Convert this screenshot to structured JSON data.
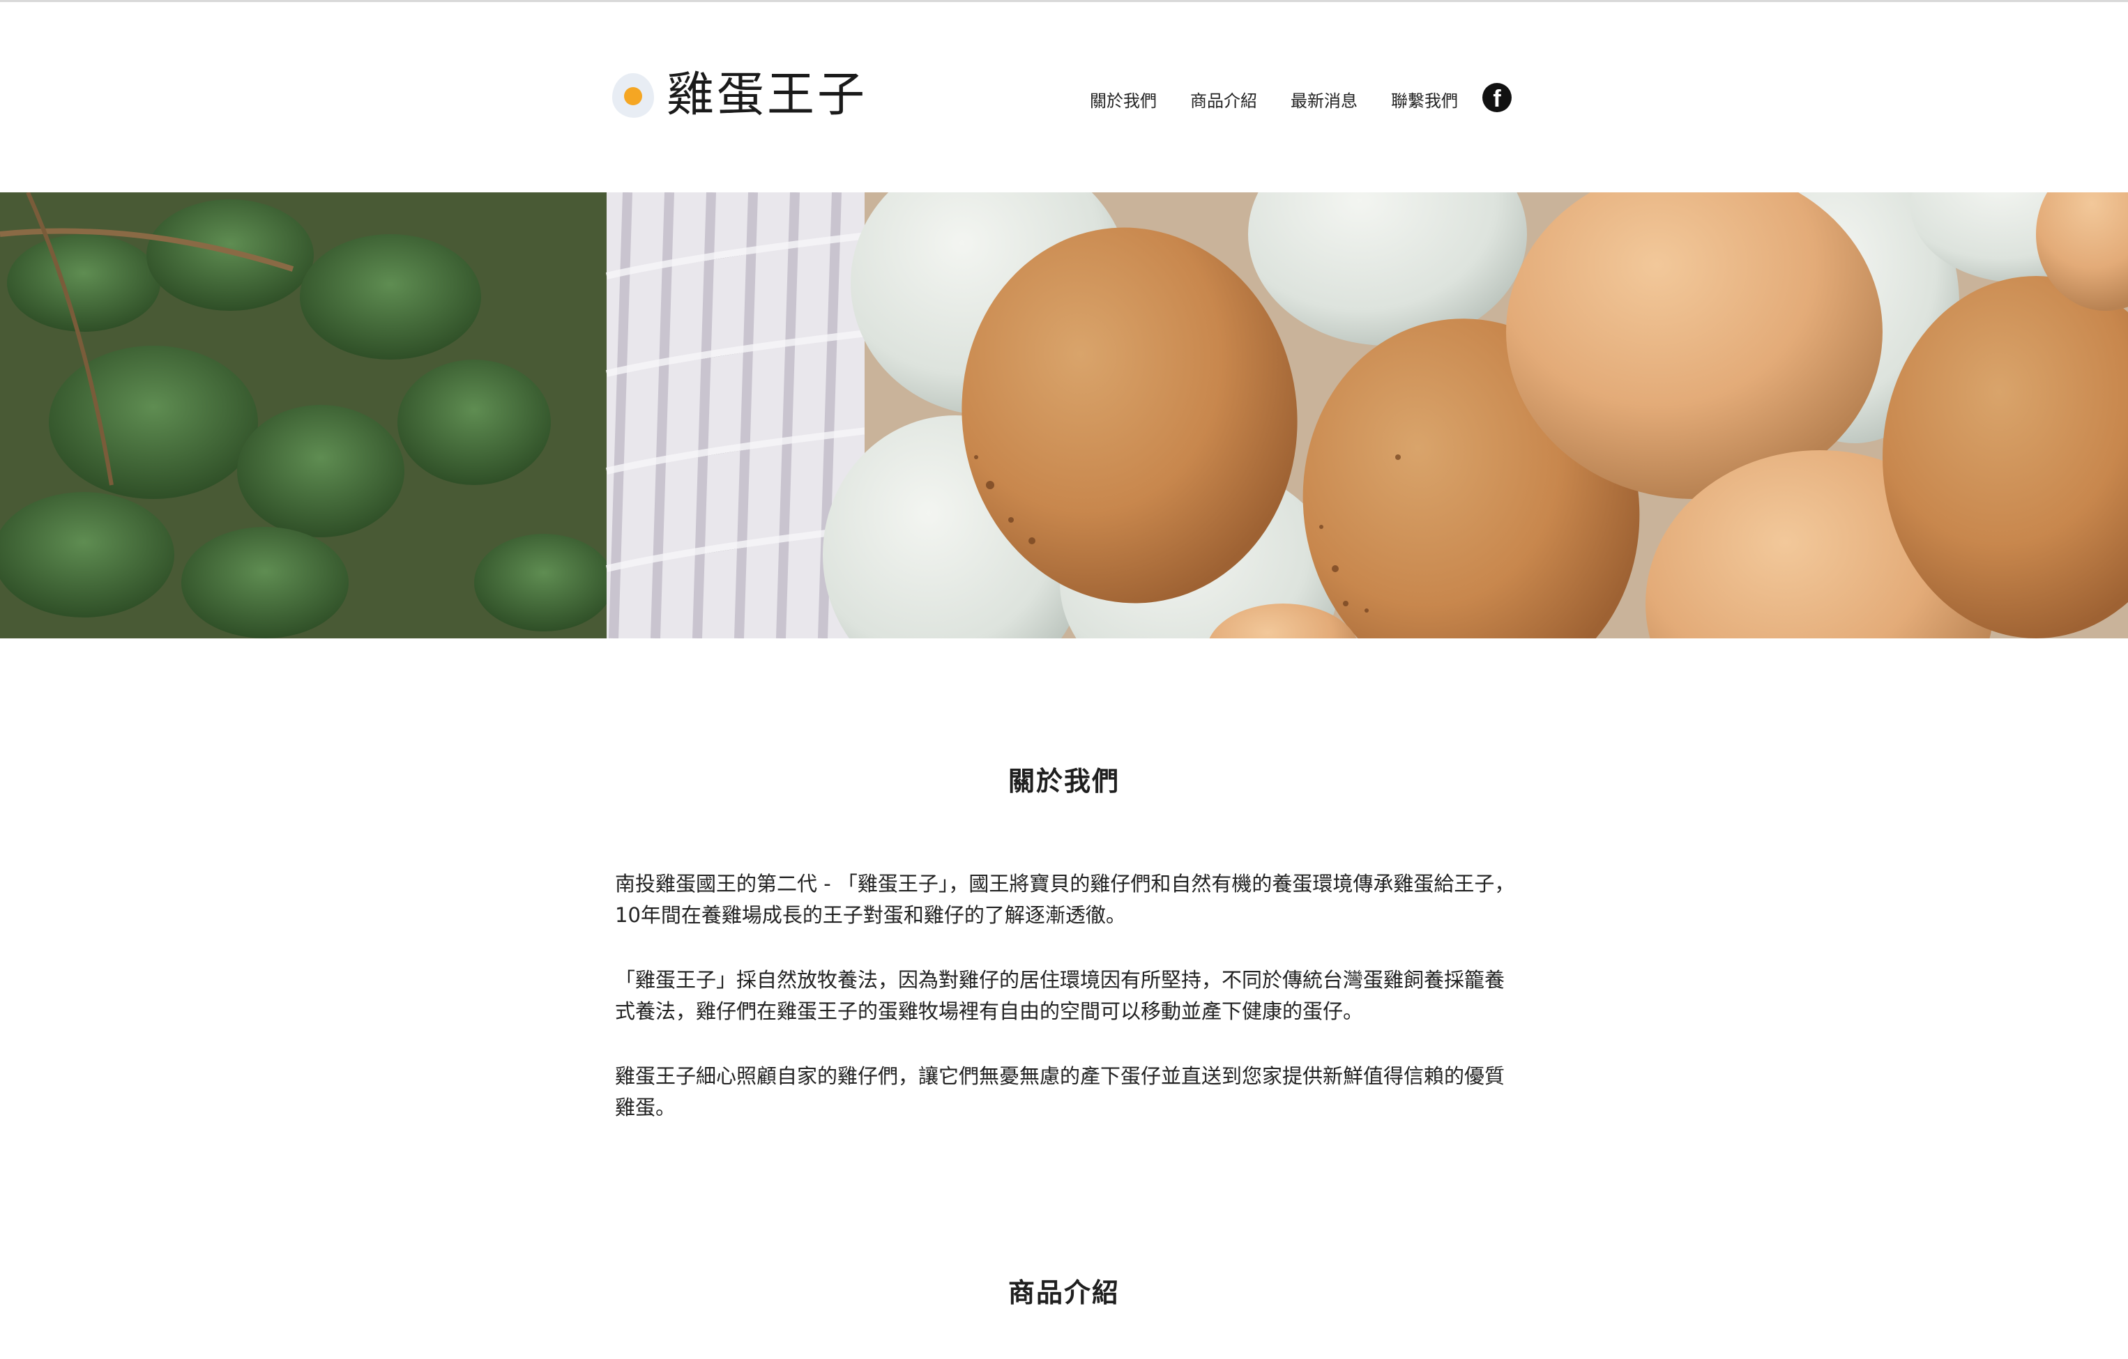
{
  "header": {
    "logo_text": "雞蛋王子",
    "nav": [
      "關於我們",
      "商品介紹",
      "最新消息",
      "聯繫我們"
    ],
    "social_icon": "facebook-icon"
  },
  "hero": {
    "image": "brown-and-white-eggs-in-basket-photo"
  },
  "about": {
    "title": "關於我們",
    "paragraphs": [
      "南投雞蛋國王的第二代 - 「雞蛋王子」，國王將寶貝的雞仔們和自然有機的養蛋環境傳承雞蛋給王子，10年間在養雞場成長的王子對蛋和雞仔的了解逐漸透徹。",
      "「雞蛋王子」採自然放牧養法，因為對雞仔的居住環境因有所堅持，不同於傳統台灣蛋雞飼養採籠養式養法，雞仔們在雞蛋王子的蛋雞牧場裡有自由的空間可以移動並產下健康的蛋仔。",
      "雞蛋王子細心照顧自家的雞仔們，讓它們無憂無慮的產下蛋仔並直送到您家提供新鮮值得信賴的優質雞蛋。"
    ]
  },
  "products": {
    "title": "商品介紹"
  },
  "colors": {
    "yolk": "#f5a623",
    "text": "#222222",
    "background": "#ffffff"
  }
}
